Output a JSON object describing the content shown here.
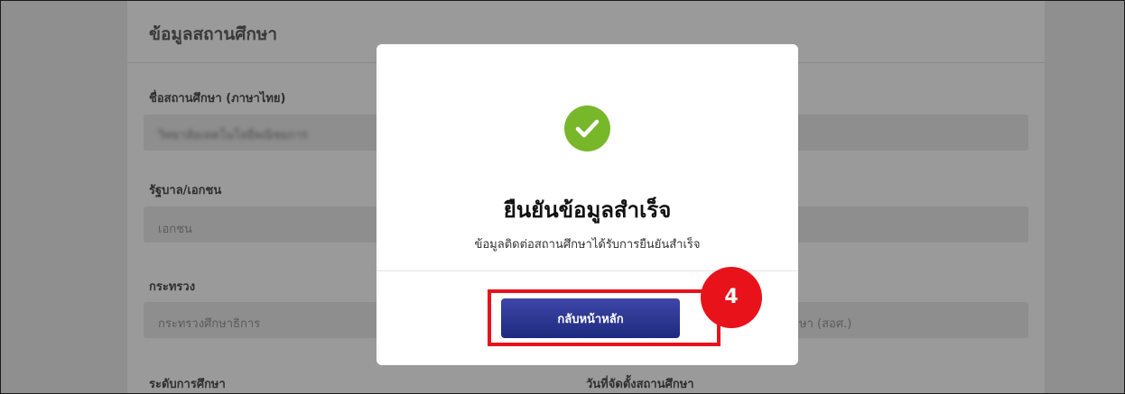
{
  "background_page": {
    "section_title": "ข้อมูลสถานศึกษา",
    "fields": [
      {
        "label": "ชื่อสถานศึกษา (ภาษาไทย)",
        "value": "วิทยาลัยเทคโนโลยีพณิชยการ"
      },
      {
        "label": "รัฐบาล/เอกชน",
        "value": "เอกชน"
      },
      {
        "label": "กระทรวง",
        "value": "กระทรวงศึกษาธิการ"
      },
      {
        "label": "ระดับการศึกษา",
        "value": ""
      }
    ],
    "right_column": {
      "ministry_agency_value": "ษา (สอศ.)",
      "founding_date_label": "วันที่จัดตั้งสถานศึกษา"
    }
  },
  "modal": {
    "icon": "check-circle-icon",
    "title": "ยืนยันข้อมูลสำเร็จ",
    "message": "ข้อมูลติดต่อสถานศึกษาได้รับการยืนยันสำเร็จ",
    "home_button_label": "กลับหน้าหลัก"
  },
  "annotation": {
    "step_number": "4"
  },
  "colors": {
    "success_green": "#78b72a",
    "button_navy": "#1e2a7e",
    "annotation_red": "#e8121b"
  }
}
